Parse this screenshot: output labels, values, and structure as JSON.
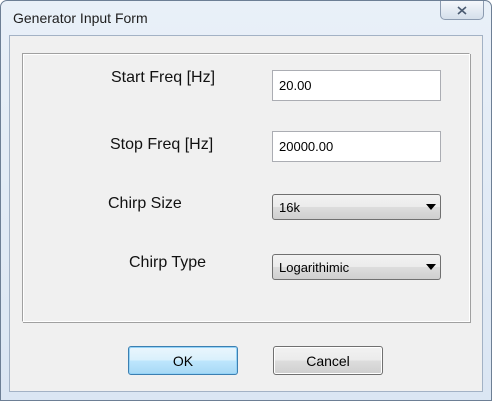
{
  "window": {
    "title": "Generator Input Form"
  },
  "form": {
    "start_freq": {
      "label": "Start Freq [Hz]",
      "value": "20.00"
    },
    "stop_freq": {
      "label": "Stop Freq [Hz]",
      "value": "20000.00"
    },
    "chirp_size": {
      "label": "Chirp Size",
      "selected": "16k"
    },
    "chirp_type": {
      "label": "Chirp Type",
      "selected": "Logarithimic"
    }
  },
  "buttons": {
    "ok_label": "OK",
    "cancel_label": "Cancel"
  },
  "icons": {
    "close": "close-icon",
    "dropdown": "chevron-down-icon"
  }
}
